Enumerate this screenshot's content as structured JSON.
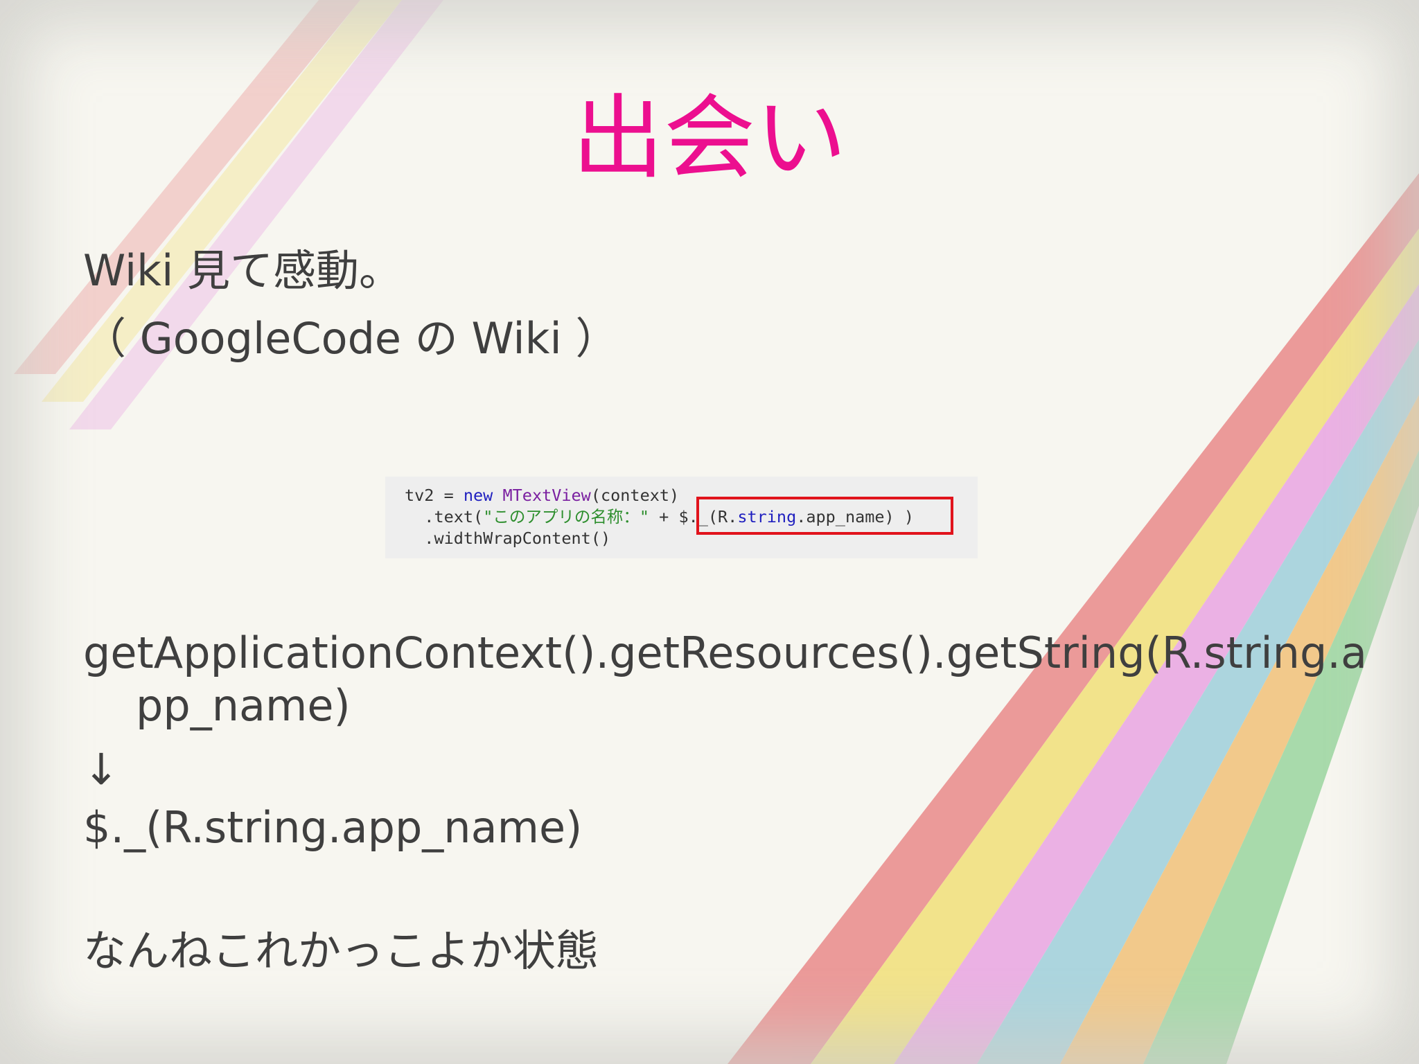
{
  "slide": {
    "title": "出会い",
    "line1": "Wiki 見て感動。",
    "line2": "（ GoogleCode の Wiki ）",
    "code": {
      "line1": {
        "a": "tv2 = ",
        "b": "new",
        "c": " ",
        "d": "MTextView",
        "e": "(context)"
      },
      "line2": {
        "a": "  .text(",
        "b": "\"このアプリの名称：\"",
        "c": " + ",
        "d": "$._(R.",
        "e": "string",
        "f": ".app_name) )"
      },
      "line3": "  .widthWrapContent()"
    },
    "line3a": "getApplicationContext().getResources().getString(R.string.a",
    "line3b": "pp_name)",
    "arrow": "↓",
    "line4": "$._(R.string.app_name)",
    "line5": "なんねこれかっこよか状態"
  },
  "colors": {
    "title": "#ec0f8f",
    "body_text": "#3f3f3f",
    "highlight_border": "#e1131c",
    "code_background": "#eeeeee"
  },
  "stripe_colors": [
    "#ea8a8a",
    "#f2e07a",
    "#e9a5e3",
    "#9fd0dc",
    "#f2c27a",
    "#9bd6a0"
  ]
}
